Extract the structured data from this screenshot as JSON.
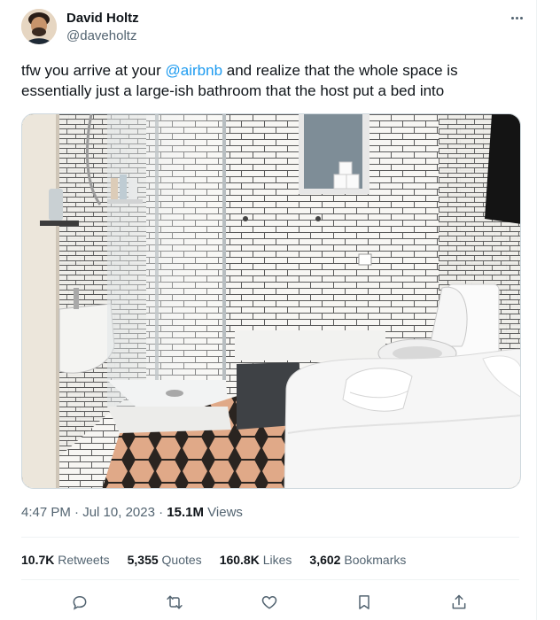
{
  "author": {
    "name": "David Holtz",
    "handle": "@daveholtz"
  },
  "tweet": {
    "text_before": "tfw you arrive at your ",
    "mention": "@airbnb",
    "text_after": " and realize that the whole space is essentially just a large-ish bathroom that the host put a bed into"
  },
  "meta": {
    "time": "4:47 PM",
    "separator1": "·",
    "date": "Jul 10, 2023",
    "separator2": "·",
    "views_count": "15.1M",
    "views_label": "Views"
  },
  "stats": {
    "retweets_count": "10.7K",
    "retweets_label": "Retweets",
    "quotes_count": "5,355",
    "quotes_label": "Quotes",
    "likes_count": "160.8K",
    "likes_label": "Likes",
    "bookmarks_count": "3,602",
    "bookmarks_label": "Bookmarks"
  },
  "icons": {
    "reply": "reply-icon",
    "retweet": "retweet-icon",
    "like": "heart-icon",
    "bookmark": "bookmark-icon",
    "share": "share-icon",
    "more": "more-icon"
  },
  "colors": {
    "accent": "#1d9bf0",
    "text": "#0f1419",
    "secondary": "#536471"
  }
}
